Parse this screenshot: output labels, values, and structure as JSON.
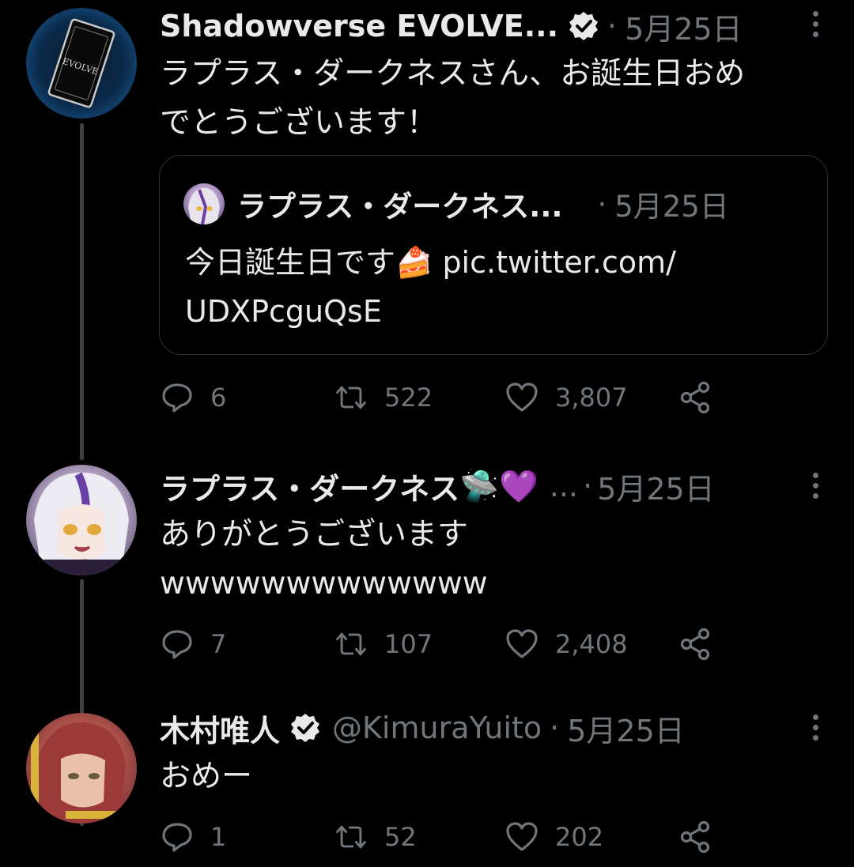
{
  "tweets": [
    {
      "display_name": "Shadowverse EVOLVE...",
      "verified": true,
      "date": "5月25日",
      "text_line1": "ラプラス・ダークネスさん、お誕生日おめ",
      "text_line2": "でとうございます！",
      "quote": {
        "display_name": "ラプラス・ダークネス...",
        "date": "5月25日",
        "text_prefix": "今日誕生日です",
        "emoji": "🍰",
        "link_line1": "pic.twitter.com/",
        "link_line2": "UDXPcguQsE"
      },
      "replies": "6",
      "retweets": "522",
      "likes": "3,807"
    },
    {
      "display_name": "ラプラス・ダークネス",
      "name_emojis": "🛸💜",
      "handle_truncated": "...",
      "date": "5月25日",
      "text_line1": "ありがとうございます",
      "text_line2": "wwwwwwwwwwwww",
      "replies": "7",
      "retweets": "107",
      "likes": "2,408"
    },
    {
      "display_name": "木村唯人",
      "verified": true,
      "handle": "@KimuraYuito",
      "date": "5月25日",
      "text_line1": "おめー",
      "replies": "1",
      "retweets": "52",
      "likes": "202"
    }
  ],
  "icons": {
    "reply": "reply-icon",
    "retweet": "retweet-icon",
    "like": "heart-icon",
    "share": "share-icon",
    "more": "more-vertical-icon",
    "verified": "verified-badge-icon"
  },
  "colors": {
    "background": "#000000",
    "text": "#e7e9ea",
    "muted": "#71767b",
    "border": "#2f3336"
  }
}
